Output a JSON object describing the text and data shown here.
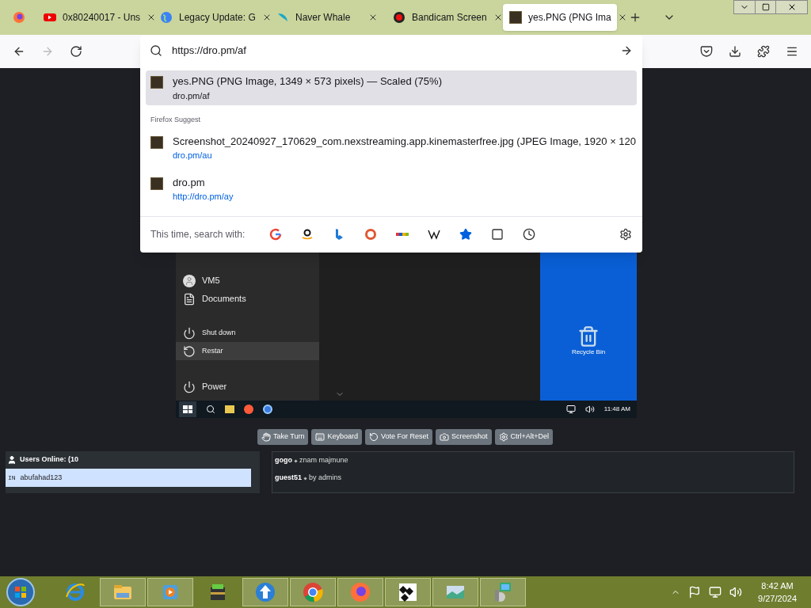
{
  "tabs": [
    {
      "kind": "youtube",
      "title": "0x80240017 - Uns",
      "selected": false
    },
    {
      "kind": "globe",
      "title": "Legacy Update: G",
      "selected": false
    },
    {
      "kind": "whale",
      "title": "Naver Whale",
      "selected": false
    },
    {
      "kind": "record",
      "title": "Bandicam Screen",
      "selected": false
    },
    {
      "kind": "image",
      "title": "yes.PNG (PNG Ima",
      "selected": true
    }
  ],
  "address_bar": {
    "value": "https://dro.pm/af"
  },
  "suggestions": [
    {
      "title": "yes.PNG (PNG Image, 1349 × 573 pixels) — Scaled (75%)",
      "url": "dro.pm/af",
      "selected": true,
      "link": false
    }
  ],
  "suggest_header": "Firefox Suggest",
  "suggest_items": [
    {
      "title": "Screenshot_20240927_170629_com.nexstreaming.app.kinemasterfree.jpg (JPEG Image, 1920 × 120",
      "url": "dro.pm/au",
      "selected": false,
      "link": true
    },
    {
      "title": "dro.pm",
      "url": "http://dro.pm/ay",
      "selected": false,
      "link": true
    }
  ],
  "search_with": {
    "label": "This time, search with:",
    "engines": [
      {
        "kind": "google"
      },
      {
        "kind": "amazon"
      },
      {
        "kind": "bing"
      },
      {
        "kind": "duckduckgo"
      },
      {
        "kind": "ebay"
      },
      {
        "kind": "wikipedia"
      },
      {
        "kind": "bookmarks"
      },
      {
        "kind": "tabs"
      },
      {
        "kind": "history"
      }
    ]
  },
  "vm": {
    "start_menu": [
      {
        "kind": "user",
        "label": "VM5",
        "selected": false
      },
      {
        "kind": "document",
        "label": "Documents",
        "selected": false
      },
      {
        "kind": "power",
        "label": "Shut down",
        "selected": false
      },
      {
        "kind": "restart",
        "label": "Restar",
        "selected": true
      },
      {
        "kind": "power",
        "label": "Power",
        "selected": false
      }
    ],
    "desktop_icon": "Recycle Bin",
    "clock": "11:48 AM"
  },
  "controls": [
    {
      "kind": "hand",
      "label": "Take Turn"
    },
    {
      "kind": "keyboard",
      "label": "Keyboard"
    },
    {
      "kind": "undo",
      "label": "Vote For Reset"
    },
    {
      "kind": "camera",
      "label": "Screenshot"
    },
    {
      "kind": "gear",
      "label": "Ctrl+Alt+Del"
    }
  ],
  "users": {
    "title": "Users Online: (10",
    "list": [
      {
        "flag": "IN",
        "name": "abufahad123",
        "selected": true
      }
    ]
  },
  "chat": [
    {
      "user": "gogo",
      "text": "znam majmune"
    },
    {
      "user": "guest51",
      "text": "by admins"
    }
  ],
  "taskbar": {
    "apps": [
      {
        "kind": "ie",
        "active": false
      },
      {
        "kind": "folder",
        "active": true
      },
      {
        "kind": "media",
        "active": true
      },
      {
        "kind": "archive",
        "active": false
      },
      {
        "kind": "update",
        "active": true
      },
      {
        "kind": "chrome",
        "active": true
      },
      {
        "kind": "firefox",
        "active": true
      },
      {
        "kind": "vm",
        "active": true
      },
      {
        "kind": "photo",
        "active": true
      },
      {
        "kind": "setup",
        "active": true
      }
    ],
    "time": "8:42 AM",
    "date": "9/27/2024"
  }
}
